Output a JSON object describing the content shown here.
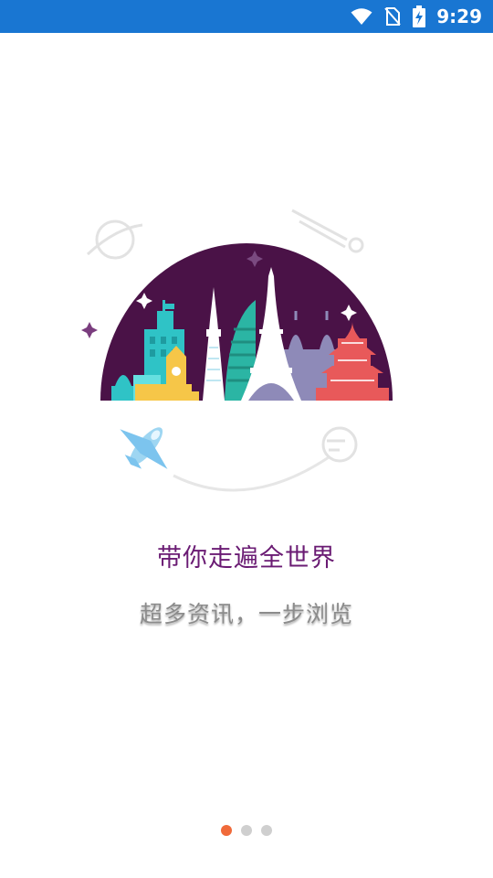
{
  "status_bar": {
    "time": "9:29",
    "icons": [
      "wifi-icon",
      "no-sim-icon",
      "battery-charging-icon"
    ],
    "color": "#1976D2"
  },
  "onboarding": {
    "title": "带你走遍全世界",
    "subtitle": "超多资讯，一步浏览",
    "illustration": "city-skyline-illustration",
    "page_indicator": {
      "total": 3,
      "current": 1
    }
  },
  "colors": {
    "accent": "#F06A3A",
    "title": "#6A1B73",
    "dome": "#4A1247"
  }
}
